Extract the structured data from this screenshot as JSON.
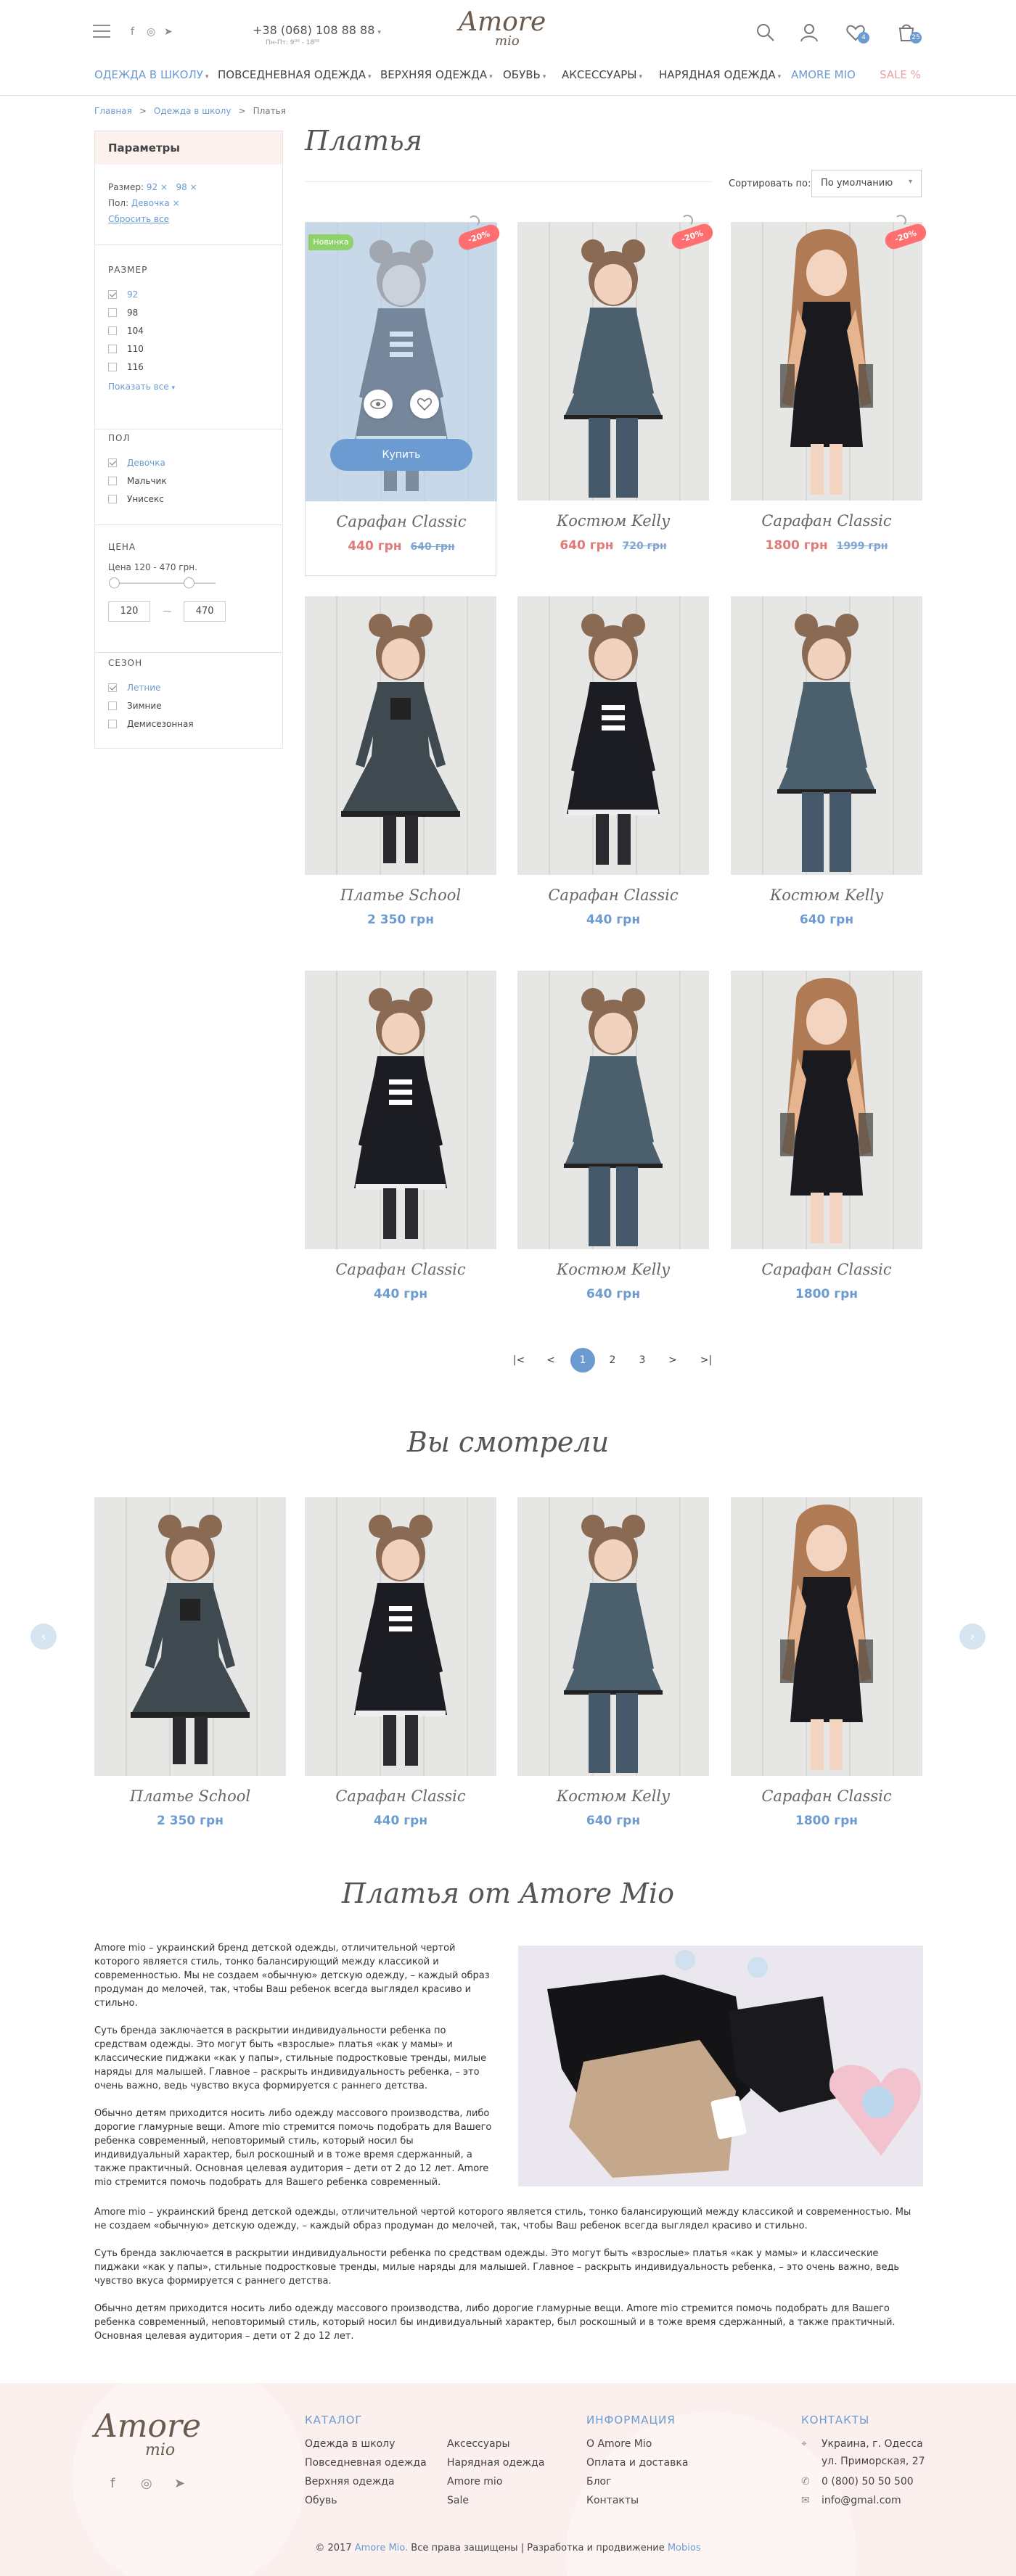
{
  "header": {
    "phone": "+38 (068) 108 88 88",
    "phone_hours": "Пн-Пт: 9⁰⁰ - 18⁰⁰",
    "logo_top": "Amore",
    "logo_bottom": "mio",
    "wishlist_count": "4",
    "cart_count": "25"
  },
  "nav": [
    {
      "label": "ОДЕЖДА В ШКОЛУ"
    },
    {
      "label": "ПОВСЕДНЕВНАЯ ОДЕЖДА"
    },
    {
      "label": "ВЕРХНЯЯ ОДЕЖДА"
    },
    {
      "label": "ОБУВЬ"
    },
    {
      "label": "АКСЕССУАРЫ"
    },
    {
      "label": "НАРЯДНАЯ ОДЕЖДА"
    },
    {
      "label": "AMORE MIO"
    },
    {
      "label": "SALE %"
    }
  ],
  "breadcrumbs": {
    "home": "Главная",
    "parent": "Одежда в школу",
    "current": "Платья",
    "sep": ">"
  },
  "filters": {
    "header": "Параметры",
    "size_label": "Размер:",
    "size_v1": "92",
    "size_v2": "98",
    "x": "×",
    "gender_label": "Пол:",
    "gender_v": "Девочка",
    "reset": "Сбросить все",
    "size_title": "РАЗМЕР",
    "sizes": [
      "92",
      "98",
      "104",
      "110",
      "116"
    ],
    "show_all": "Показать все",
    "gender_title": "ПОЛ",
    "genders": [
      "Девочка",
      "Мальчик",
      "Унисекс"
    ],
    "price_title": "ЦЕНА",
    "price_range": "Цена 120 - 470 грн.",
    "price_min": "120",
    "price_max": "470",
    "price_dash": "—",
    "season_title": "СЕЗОН",
    "seasons": [
      "Летние",
      "Зимние",
      "Демисезонная"
    ]
  },
  "catalog": {
    "title": "Платья",
    "sort_label": "Сортировать по:",
    "sort_value": "По умолчанию",
    "buy": "Купить",
    "new_badge": "Новинка",
    "products": [
      {
        "name": "Сарафан Classic",
        "price": "440 грн",
        "old": "640 грн",
        "disc": "-20%"
      },
      {
        "name": "Костюм Kelly",
        "price": "640 грн",
        "old": "720 грн",
        "disc": "-20%"
      },
      {
        "name": "Сарафан Classic",
        "price": "1800 грн",
        "old": "1999 грн",
        "disc": "-20%"
      },
      {
        "name": "Платье School",
        "price": "2 350 грн"
      },
      {
        "name": "Сарафан Classic",
        "price": "440 грн"
      },
      {
        "name": "Костюм Kelly",
        "price": "640 грн"
      },
      {
        "name": "Сарафан Classic",
        "price": "440 грн"
      },
      {
        "name": "Костюм Kelly",
        "price": "640 грн"
      },
      {
        "name": "Сарафан Classic",
        "price": "1800 грн"
      }
    ]
  },
  "pager": {
    "first": "|<",
    "prev": "<",
    "p1": "1",
    "p2": "2",
    "p3": "3",
    "next": ">",
    "last": ">|"
  },
  "viewed": {
    "title": "Вы смотрели",
    "items": [
      {
        "name": "Платье School",
        "price": "2 350 грн"
      },
      {
        "name": "Сарафан Classic",
        "price": "440 грн"
      },
      {
        "name": "Костюм Kelly",
        "price": "640 грн"
      },
      {
        "name": "Сарафан Classic",
        "price": "1800 грн"
      }
    ]
  },
  "seo": {
    "title": "Платья от Amore Mio",
    "p1": "Amore mio – украинский бренд детской одежды, отличительной чертой которого является стиль, тонко балансирующий между классикой и современностью. Мы не создаем «обычную» детскую одежду, – каждый образ продуман до мелочей, так, чтобы Ваш ребенок всегда выглядел красиво и стильно.",
    "p2": "Суть бренда заключается в раскрытии индивидуальности ребенка по средствам одежды. Это могут быть «взрослые» платья «как у мамы» и классические пиджаки «как у папы», стильные подростковые тренды, милые наряды для малышей. Главное – раскрыть индивидуальность ребенка, – это очень важно, ведь чувство вкуса формируется с раннего детства.",
    "p3": "Обычно детям приходится носить либо одежду массового производства, либо дорогие гламурные вещи. Amore mio стремится помочь подобрать для Вашего ребенка современный, неповторимый стиль, который носил бы индивидуальный характер, был роскошный и в тоже время сдержанный, а также практичный. Основная целевая аудитория – дети от 2 до 12 лет. Amore mio стремится помочь подобрать для Вашего ребенка современный.",
    "p4": "Amore mio – украинский бренд детской одежды, отличительной чертой которого является стиль, тонко балансирующий между классикой и современностью. Мы не создаем «обычную» детскую одежду, – каждый образ продуман до мелочей, так, чтобы Ваш ребенок всегда выглядел красиво и стильно.",
    "p5": "Суть бренда заключается в раскрытии индивидуальности ребенка по средствам одежды. Это могут быть «взрослые» платья «как у мамы» и классические пиджаки «как у папы», стильные подростковые тренды, милые наряды для малышей. Главное – раскрыть индивидуальность ребенка, – это очень важно, ведь чувство вкуса формируется с раннего детства.",
    "p6": "Обычно детям приходится носить либо одежду массового производства, либо дорогие гламурные вещи. Amore mio стремится помочь подобрать для Вашего ребенка современный, неповторимый стиль, который носил бы индивидуальный характер, был роскошный и в тоже время сдержанный, а также практичный. Основная целевая аудитория – дети от 2 до 12 лет."
  },
  "footer": {
    "catalog_title": "КАТАЛОГ",
    "catalog_links": [
      "Одежда в школу",
      "Повседневная одежда",
      "Верхняя одежда",
      "Обувь",
      "Аксессуары",
      "Нарядная одежда",
      "Amore mio",
      "Sale"
    ],
    "info_title": "ИНФОРМАЦИЯ",
    "info_links": [
      "О Amore Mio",
      "Оплата и доставка",
      "Блог",
      "Контакты"
    ],
    "contacts_title": "КОНТАКТЫ",
    "address1": "Украина, г. Одесса",
    "address2": "ул. Приморская, 27",
    "phone": "0 (800) 50 50 500",
    "email": "info@gmal.com",
    "copy_pre": "© 2017",
    "copy_brand": "Amore Mio.",
    "copy_rights": "Все права защищены",
    "copy_sep": "|",
    "copy_dev": "Разработка и продвижение",
    "copy_studio": "Mobios"
  },
  "colors": {
    "accent": "#6c9bd2",
    "sale": "#e07a78",
    "badge_new": "#8fd16b",
    "discount": "#ff6f6f",
    "footer_bg": "#fbf0ed"
  }
}
